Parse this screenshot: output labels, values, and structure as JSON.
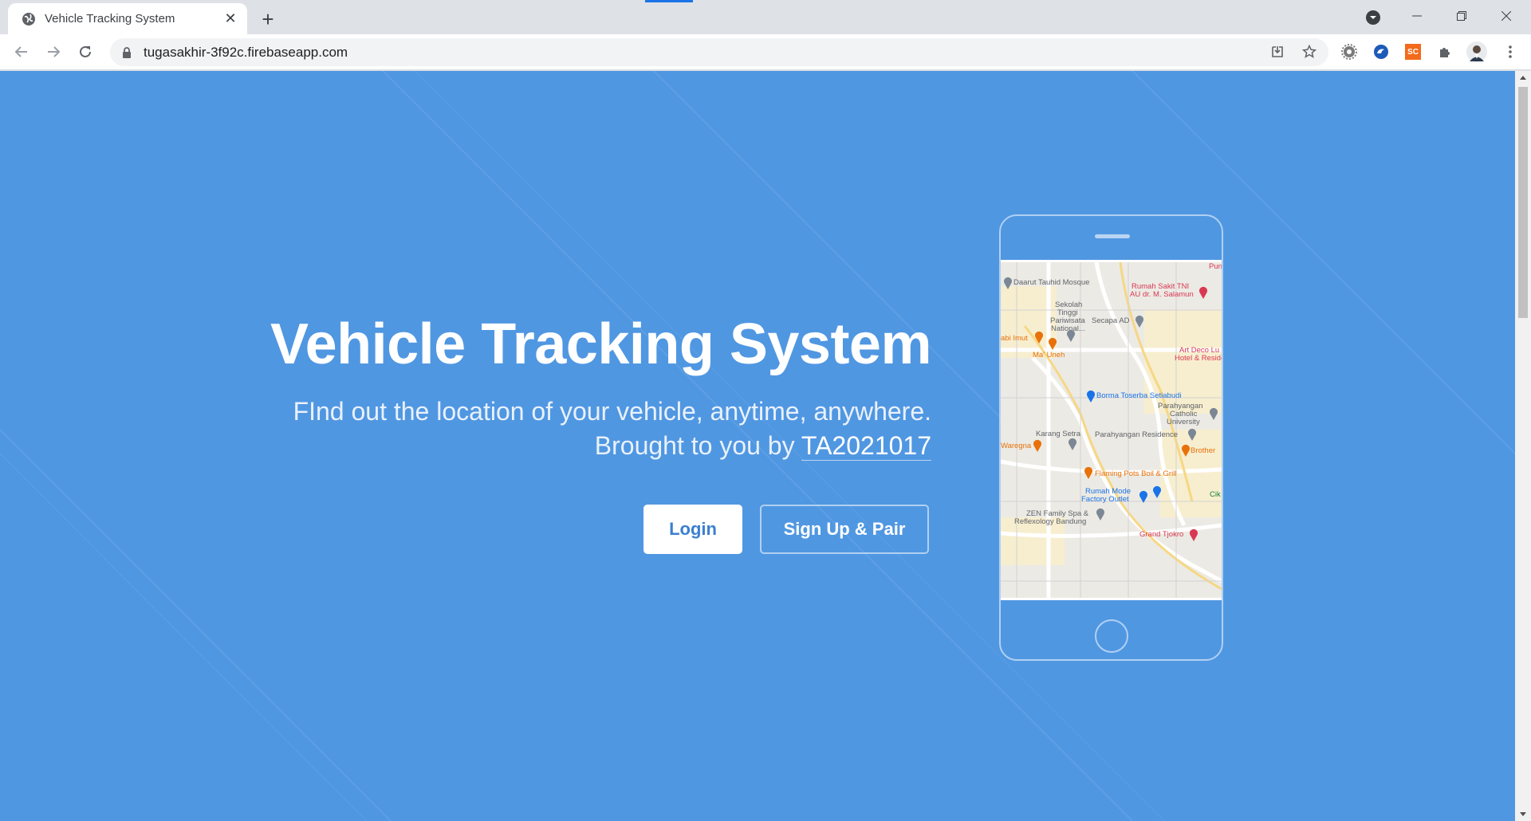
{
  "browser": {
    "tab_title": "Vehicle Tracking System",
    "tab_close": "✕",
    "new_tab": "+",
    "url": "tugasakhir-3f92c.firebaseapp.com",
    "extensions": [
      "gear-extension",
      "edge-extension",
      "sc-extension",
      "puzzle-extension",
      "profile-avatar"
    ],
    "sc_label": "SC"
  },
  "hero": {
    "title": "Vehicle Tracking System",
    "subtitle_line1": "FInd out the location of your vehicle, anytime, anywhere.",
    "subtitle_prefix": "Brought to you by",
    "team": "TA2021017",
    "login_label": "Login",
    "signup_label": "Sign Up & Pair"
  },
  "map": {
    "labels": [
      {
        "text": "Daarut Tauhid Mosque",
        "color": "gray"
      },
      {
        "text": "Rumah Sakit TNI",
        "color": "red"
      },
      {
        "text": "AU dr. M. Salamun",
        "color": "red"
      },
      {
        "text": "Sekolah",
        "color": "gray"
      },
      {
        "text": "Tinggi",
        "color": "gray"
      },
      {
        "text": "Pariwisata",
        "color": "gray"
      },
      {
        "text": "National...",
        "color": "gray"
      },
      {
        "text": "Secapa AD",
        "color": "gray"
      },
      {
        "text": "abi Imut",
        "color": "orange"
      },
      {
        "text": "Ma' Uneh",
        "color": "orange"
      },
      {
        "text": "Art Deco Lu",
        "color": "red"
      },
      {
        "text": "Hotel & Reside",
        "color": "red"
      },
      {
        "text": "Borma Toserba Setiabudi",
        "color": "blue"
      },
      {
        "text": "Parahyangan",
        "color": "gray"
      },
      {
        "text": "Catholic",
        "color": "gray"
      },
      {
        "text": "University",
        "color": "gray"
      },
      {
        "text": "Karang Setra",
        "color": "gray"
      },
      {
        "text": "Parahyangan Residence",
        "color": "gray"
      },
      {
        "text": "Waregna",
        "color": "orange"
      },
      {
        "text": "Brother",
        "color": "orange"
      },
      {
        "text": "Flaming Pots Boil & Grill",
        "color": "orange"
      },
      {
        "text": "Rumah Mode",
        "color": "blue"
      },
      {
        "text": "Factory Outlet",
        "color": "blue"
      },
      {
        "text": "Cik",
        "color": "green"
      },
      {
        "text": "ZEN Family Spa &",
        "color": "gray"
      },
      {
        "text": "Reflexology Bandung",
        "color": "gray"
      },
      {
        "text": "Grand Tjokro",
        "color": "red"
      },
      {
        "text": "Pun",
        "color": "red"
      }
    ]
  }
}
